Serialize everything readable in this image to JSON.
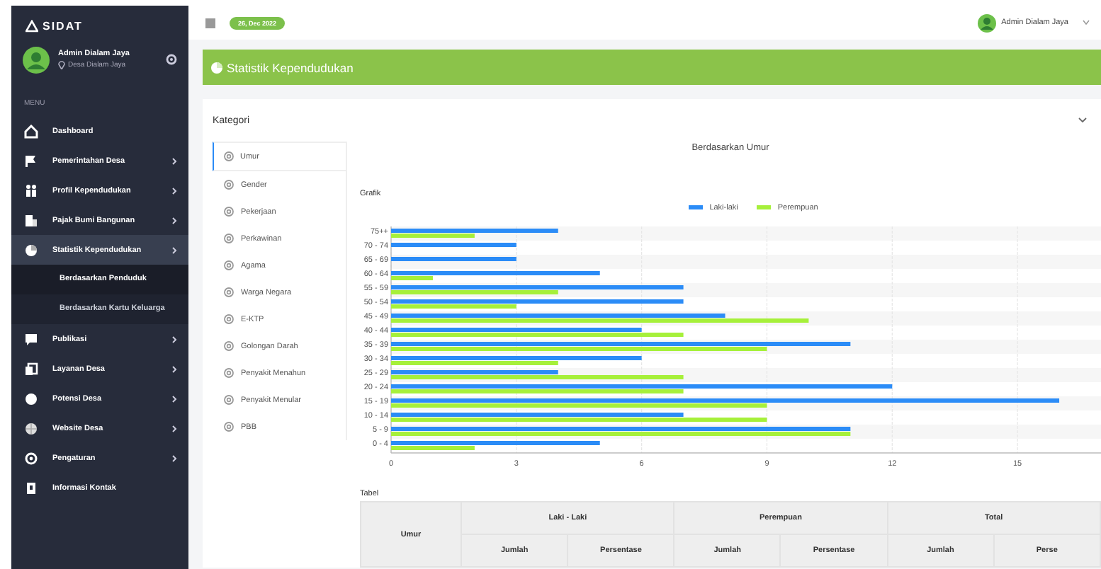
{
  "sidebar": {
    "logo": "SIDAT",
    "user": {
      "name": "Admin Dialam Jaya",
      "location": "Desa Dialam Jaya"
    },
    "menu_label": "MENU",
    "items": [
      {
        "label": "Dashboard",
        "has_submenu": false,
        "selected": false
      },
      {
        "label": "Pemerintahan Desa",
        "has_submenu": true,
        "selected": false
      },
      {
        "label": "Profil Kependudukan",
        "has_submenu": true,
        "selected": false
      },
      {
        "label": "Pajak Bumi Bangunan",
        "has_submenu": true,
        "selected": false
      },
      {
        "label": "Statistik Kependudukan",
        "has_submenu": true,
        "selected": true,
        "expanded": true,
        "children": [
          {
            "label": "Berdasarkan Penduduk",
            "selected": true
          },
          {
            "label": "Berdasarkan Kartu Keluarga",
            "selected": false
          }
        ]
      },
      {
        "label": "Publikasi",
        "has_submenu": true,
        "selected": false
      },
      {
        "label": "Layanan Desa",
        "has_submenu": true,
        "selected": false
      },
      {
        "label": "Potensi Desa",
        "has_submenu": true,
        "selected": false
      },
      {
        "label": "Website Desa",
        "has_submenu": true,
        "selected": false
      },
      {
        "label": "Pengaturan",
        "has_submenu": true,
        "selected": false
      },
      {
        "label": "Informasi Kontak",
        "has_submenu": false,
        "selected": false
      }
    ]
  },
  "topbar": {
    "date": "26, Dec 2022",
    "user": "Admin Dialam Jaya"
  },
  "page_header": {
    "title": "Statistik Kependudukan"
  },
  "card": {
    "title": "Kategori",
    "categories": [
      {
        "label": "Umur",
        "selected": true
      },
      {
        "label": "Gender",
        "selected": false
      },
      {
        "label": "Pekerjaan",
        "selected": false
      },
      {
        "label": "Perkawinan",
        "selected": false
      },
      {
        "label": "Agama",
        "selected": false
      },
      {
        "label": "Warga Negara",
        "selected": false
      },
      {
        "label": "E-KTP",
        "selected": false
      },
      {
        "label": "Golongan Darah",
        "selected": false
      },
      {
        "label": "Penyakit Menahun",
        "selected": false
      },
      {
        "label": "Penyakit Menular",
        "selected": false
      },
      {
        "label": "PBB",
        "selected": false
      }
    ],
    "heading": "Berdasarkan Umur",
    "chart_label": "Grafik",
    "chart_data": {
      "type": "bar",
      "orientation": "horizontal",
      "categories": [
        "75++",
        "70 - 74",
        "65 - 69",
        "60 - 64",
        "55 - 59",
        "50 - 54",
        "45 - 49",
        "40 - 44",
        "35 - 39",
        "30 - 34",
        "25 - 29",
        "20 - 24",
        "15 - 19",
        "10 - 14",
        "5 - 9",
        "0 - 4"
      ],
      "series": [
        {
          "name": "Laki-laki",
          "color": "#2b8cf7",
          "values": [
            4,
            3,
            3,
            5,
            7,
            7,
            8,
            6,
            11,
            6,
            4,
            12,
            16,
            7,
            11,
            5
          ]
        },
        {
          "name": "Perempuan",
          "color": "#a6f03a",
          "values": [
            2,
            0,
            0,
            1,
            4,
            3,
            10,
            7,
            9,
            4,
            7,
            7,
            9,
            9,
            11,
            2
          ]
        }
      ],
      "xticks": [
        0,
        3,
        6,
        9,
        12,
        15
      ],
      "xlim": [
        0,
        17
      ],
      "grid": true,
      "legend": true
    },
    "table_label": "Tabel",
    "table": {
      "row_header": "Umur",
      "groups": [
        {
          "label": "Laki - Laki",
          "columns": [
            "Jumlah",
            "Persentase"
          ]
        },
        {
          "label": "Perempuan",
          "columns": [
            "Jumlah",
            "Persentase"
          ]
        },
        {
          "label": "Total",
          "columns": [
            "Jumlah",
            "Perse"
          ]
        }
      ]
    }
  }
}
